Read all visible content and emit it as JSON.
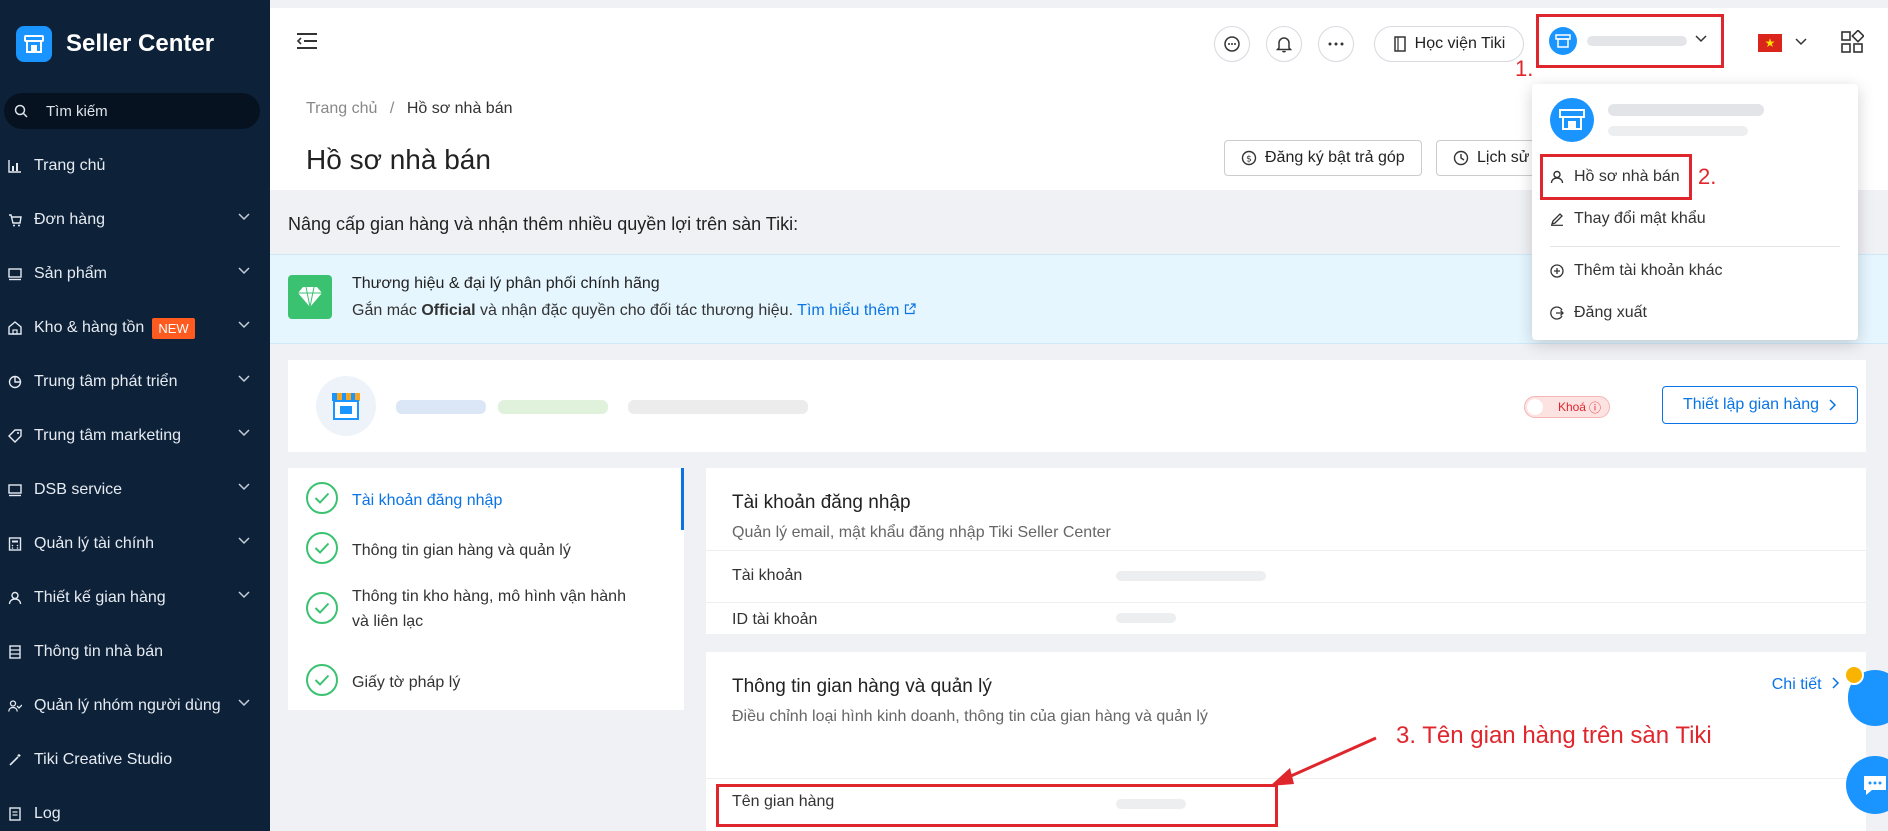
{
  "sidebar": {
    "brand": "Seller Center",
    "search_label": "Tìm kiếm",
    "items": [
      {
        "label": "Trang chủ",
        "icon": "chart-icon",
        "has_children": false
      },
      {
        "label": "Đơn hàng",
        "icon": "cart-icon",
        "has_children": true
      },
      {
        "label": "Sản phẩm",
        "icon": "monitor-icon",
        "has_children": true
      },
      {
        "label": "Kho & hàng tồn",
        "icon": "warehouse-icon",
        "has_children": true,
        "badge": "NEW"
      },
      {
        "label": "Trung tâm phát triển",
        "icon": "pie-icon",
        "has_children": true
      },
      {
        "label": "Trung tâm marketing",
        "icon": "tag-icon",
        "has_children": true
      },
      {
        "label": "DSB service",
        "icon": "monitor-icon",
        "has_children": true
      },
      {
        "label": "Quản lý tài chính",
        "icon": "calculator-icon",
        "has_children": true
      },
      {
        "label": "Thiết kế gian hàng",
        "icon": "user-icon",
        "has_children": true
      },
      {
        "label": "Thông tin nhà bán",
        "icon": "building-icon",
        "has_children": false
      },
      {
        "label": "Quản lý nhóm người dùng",
        "icon": "users-icon",
        "has_children": true
      },
      {
        "label": "Tiki Creative Studio",
        "icon": "magic-icon",
        "has_children": false
      },
      {
        "label": "Log",
        "icon": "log-icon",
        "has_children": false
      }
    ]
  },
  "header": {
    "academy_label": "Học viện Tiki",
    "anno1": "1."
  },
  "breadcrumb": {
    "home": "Trang chủ",
    "sep": "/",
    "current": "Hồ sơ nhà bán"
  },
  "page": {
    "title": "Hồ sơ nhà bán",
    "btn_installment": "Đăng ký bật trả góp",
    "btn_history": "Lịch sử"
  },
  "upgrade": {
    "title": "Nâng cấp gian hàng và nhận thêm nhiều quyền lợi trên sàn Tiki:",
    "banner_title": "Thương hiệu & đại lý phân phối chính hãng",
    "banner_desc_before": "Gắn mác ",
    "banner_desc_bold": "Official",
    "banner_desc_after": " và nhận đặc quyền cho đối tác thương hiệu. ",
    "banner_link": "Tìm hiểu thêm"
  },
  "store": {
    "lock_label": "Khoá",
    "setup_btn": "Thiết lập gian hàng"
  },
  "steps": [
    {
      "label": "Tài khoản đăng nhập",
      "active": true
    },
    {
      "label": "Thông tin gian hàng và quản lý",
      "active": false
    },
    {
      "label": "Thông tin kho hàng, mô hình vận hành và liên lạc",
      "active": false
    },
    {
      "label": "Giấy tờ pháp lý",
      "active": false
    }
  ],
  "login_panel": {
    "title": "Tài khoản đăng nhập",
    "subtitle": "Quản lý email, mật khẩu đăng nhập Tiki Seller Center",
    "row_account": "Tài khoản",
    "row_id": "ID tài khoản"
  },
  "store_panel": {
    "title": "Thông tin gian hàng và quản lý",
    "subtitle": "Điều chỉnh loại hình kinh doanh, thông tin của gian hàng và quản lý",
    "detail_link": "Chi tiết",
    "row_store_name": "Tên gian hàng"
  },
  "dropdown": {
    "profile": "Hồ sơ nhà bán",
    "change_password": "Thay đổi mật khẩu",
    "add_account": "Thêm tài khoản khác",
    "logout": "Đăng xuất",
    "anno2": "2."
  },
  "annotation3": "3. Tên gian hàng trên sàn Tiki",
  "colors": {
    "sidebar_bg": "#0d2138",
    "primary": "#0b74e5",
    "annotation": "#e0262d",
    "success": "#3ac271"
  }
}
